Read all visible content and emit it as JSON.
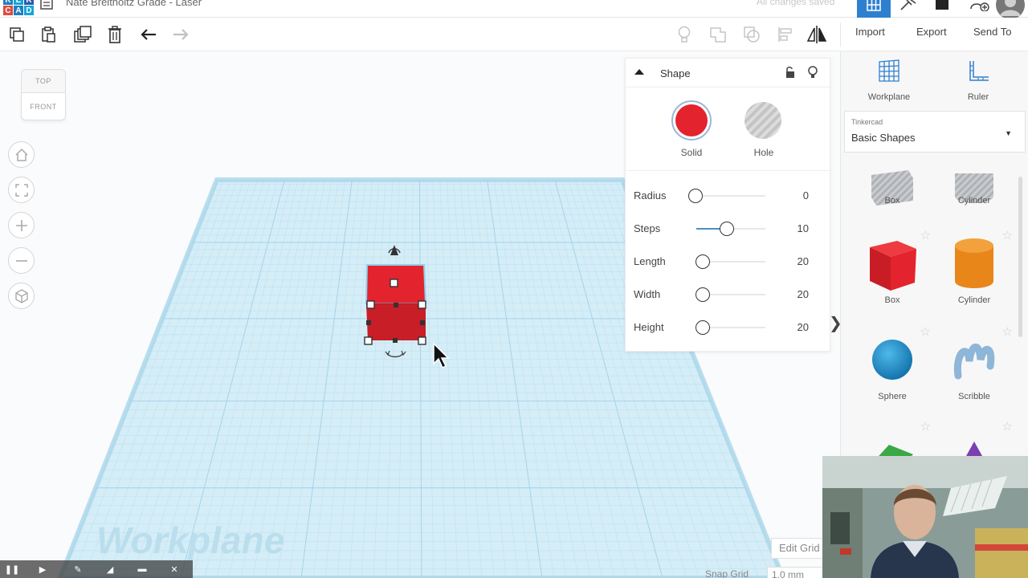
{
  "app": {
    "logo_letters": [
      "T",
      "I",
      "N",
      "K",
      "E",
      "R",
      "C",
      "A",
      "D"
    ],
    "logo_colors": [
      "#1d7fc1",
      "#16a3d8",
      "#2a5ba8",
      "#e04a3f",
      "#1d7fc1",
      "#16a3d8"
    ],
    "document_title": "Nate Breitholtz Grade - Laser",
    "save_status": "All changes saved"
  },
  "toolbar": {
    "import_label": "Import",
    "export_label": "Export",
    "send_to_label": "Send To"
  },
  "canvas": {
    "view_cube": {
      "top_label": "TOP",
      "front_label": "FRONT"
    },
    "watermark": "Workplane",
    "edit_grid_label": "Edit Grid",
    "snap_grid_label": "Snap Grid",
    "snap_grid_value": "1.0 mm",
    "plane_color": "#d4edf7",
    "grid_color": "#9ccfe6",
    "selected_color": "#e3232d"
  },
  "inspector": {
    "title": "Shape",
    "solid_label": "Solid",
    "hole_label": "Hole",
    "solid_color": "#e3232d",
    "properties": [
      {
        "label": "Radius",
        "value": "0",
        "level": 0.0
      },
      {
        "label": "Steps",
        "value": "10",
        "level": 0.45
      },
      {
        "label": "Length",
        "value": "20",
        "level": 0.1
      },
      {
        "label": "Width",
        "value": "20",
        "level": 0.1
      },
      {
        "label": "Height",
        "value": "20",
        "level": 0.1
      }
    ]
  },
  "panel": {
    "workplane_label": "Workplane",
    "ruler_label": "Ruler",
    "library_source": "Tinkercad",
    "library_name": "Basic Shapes",
    "shapes": [
      {
        "name": "Box",
        "icon": "box-hole-icon",
        "color": "#b9bcc0"
      },
      {
        "name": "Cylinder",
        "icon": "cylinder-hole-icon",
        "color": "#b9bcc0"
      },
      {
        "name": "Box",
        "icon": "box-icon",
        "color": "#e3232d"
      },
      {
        "name": "Cylinder",
        "icon": "cylinder-icon",
        "color": "#e8861a"
      },
      {
        "name": "Sphere",
        "icon": "sphere-icon",
        "color": "#1b95d3"
      },
      {
        "name": "Scribble",
        "icon": "scribble-icon",
        "color": "#8db6d8"
      },
      {
        "name": "",
        "icon": "roof-icon",
        "color": "#3aa845"
      },
      {
        "name": "",
        "icon": "cone-icon",
        "color": "#7b3fb0"
      }
    ]
  }
}
